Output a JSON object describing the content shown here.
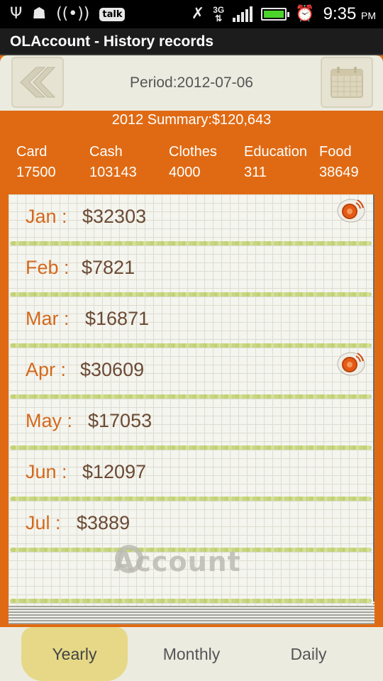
{
  "status_bar": {
    "icons": [
      "usb-icon",
      "android-debug-icon",
      "wifi-hotspot-icon",
      "talk-icon",
      "no-sync-icon",
      "3g-icon",
      "signal-icon",
      "battery-icon",
      "alarm-icon"
    ],
    "talk_label": "talk",
    "network_label": "3G",
    "battery_level": 1.0,
    "time": "9:35",
    "ampm": "PM"
  },
  "title_bar": {
    "title": "OLAccount - History records"
  },
  "header": {
    "period": "Period:2012-07-06"
  },
  "summary": {
    "text": "2012 Summary:$120,643",
    "categories": [
      {
        "name": "Card",
        "value": "17500"
      },
      {
        "name": "Cash",
        "value": "103143"
      },
      {
        "name": "Clothes",
        "value": "4000"
      },
      {
        "name": "Education",
        "value": "311"
      },
      {
        "name": "Food",
        "value": "38649"
      }
    ]
  },
  "records": [
    {
      "month": "Jan :",
      "amount": "$32303",
      "has_icon": true
    },
    {
      "month": "Feb :",
      "amount": "$7821",
      "has_icon": false
    },
    {
      "month": "Mar :",
      "amount": "$16871",
      "has_icon": false
    },
    {
      "month": "Apr :",
      "amount": "$30609",
      "has_icon": true
    },
    {
      "month": "May :",
      "amount": "$17053",
      "has_icon": false
    },
    {
      "month": "Jun :",
      "amount": "$12097",
      "has_icon": false
    },
    {
      "month": "Jul :",
      "amount": "$3889",
      "has_icon": false
    }
  ],
  "watermark": "Account",
  "tabs": [
    {
      "label": "Yearly",
      "active": true
    },
    {
      "label": "Monthly",
      "active": false
    },
    {
      "label": "Daily",
      "active": false
    }
  ],
  "colors": {
    "accent": "#e06a13",
    "month_text": "#d4681a",
    "amount_text": "#6b4a34",
    "tab_active": "#e6d887"
  }
}
